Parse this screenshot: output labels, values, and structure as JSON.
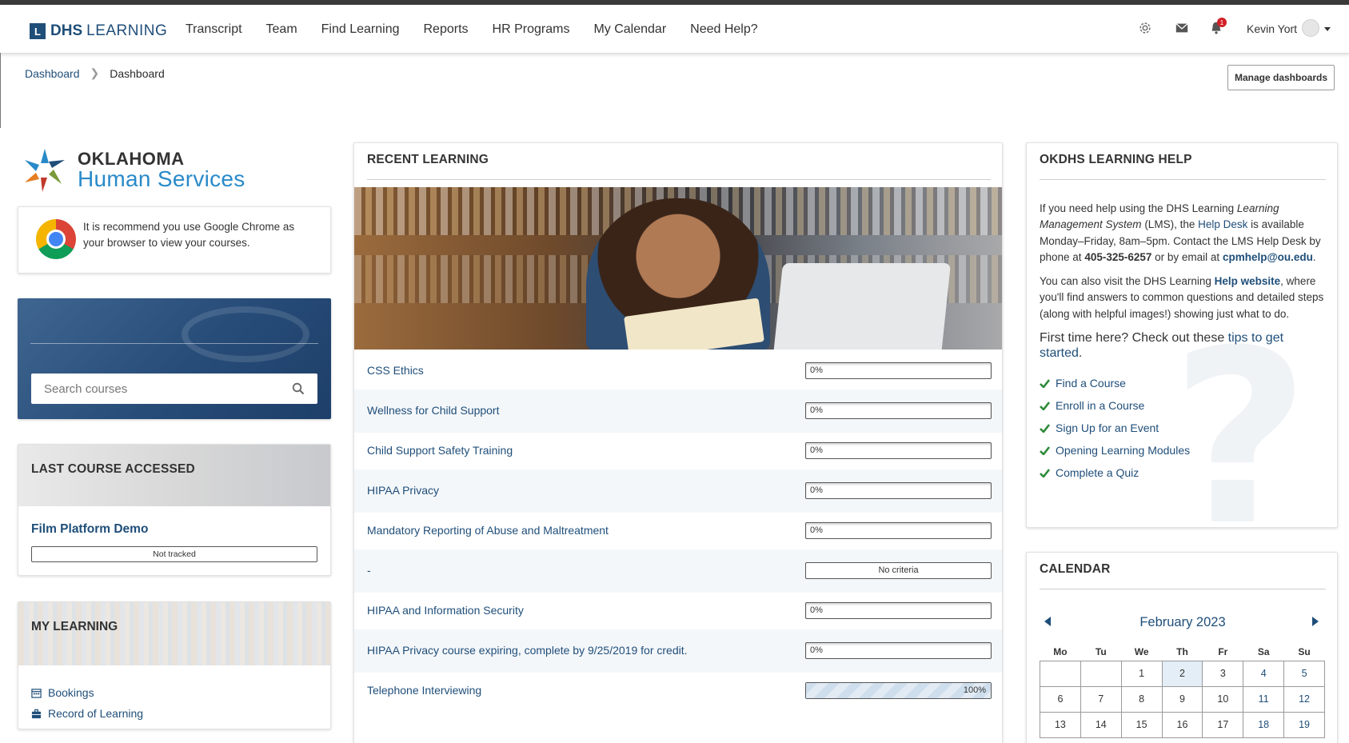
{
  "brand": {
    "box": "L",
    "bold": "DHS",
    "light": "LEARNING"
  },
  "nav": {
    "items": [
      "Transcript",
      "Team",
      "Find Learning",
      "Reports",
      "HR Programs",
      "My Calendar",
      "Need Help?"
    ],
    "icons": [
      "gear-icon",
      "envelope-icon",
      "bell-icon"
    ],
    "notification_count": "1",
    "user_name": "Kevin Yort"
  },
  "breadcrumb": {
    "link": "Dashboard",
    "current": "Dashboard"
  },
  "manage_dashboards": "Manage dashboards",
  "logo": {
    "line1": "OKLAHOMA",
    "line2": "Human Services"
  },
  "chrome_notice": "It is recommend you use Google Chrome as your browser to view your courses.",
  "search": {
    "placeholder": "Search courses"
  },
  "last_course": {
    "title": "LAST COURSE ACCESSED",
    "course": "Film Platform Demo",
    "status": "Not tracked"
  },
  "my_learning": {
    "title": "MY LEARNING",
    "items": [
      "Bookings",
      "Record of Learning"
    ]
  },
  "recent_learning": {
    "title": "RECENT LEARNING",
    "rows": [
      {
        "name": "CSS Ethics",
        "progress": "0%",
        "value": 0
      },
      {
        "name": "Wellness for Child Support",
        "progress": "0%",
        "value": 0
      },
      {
        "name": "Child Support Safety Training",
        "progress": "0%",
        "value": 0
      },
      {
        "name": "HIPAA Privacy",
        "progress": "0%",
        "value": 0
      },
      {
        "name": "Mandatory Reporting of Abuse and Maltreatment",
        "progress": "0%",
        "value": 0
      },
      {
        "name": "-",
        "progress": "No criteria",
        "value": null
      },
      {
        "name": "HIPAA and Information Security",
        "progress": "0%",
        "value": 0
      },
      {
        "name": "HIPAA Privacy course expiring, complete by 9/25/2019 for credit.",
        "progress": "0%",
        "value": 0
      },
      {
        "name": "Telephone Interviewing",
        "progress": "100%",
        "value": 100
      }
    ]
  },
  "help": {
    "title": "OKDHS LEARNING HELP",
    "p1_a": "If you need help using the DHS Learning ",
    "p1_italic": "Learning Management System",
    "p1_b": " (LMS), the ",
    "p1_link": "Help Desk",
    "p1_c": " is available Monday–Friday, 8am–5pm. Contact the LMS Help Desk by phone at ",
    "phone": "405-325-6257",
    "p1_d": " or by email at ",
    "email": "cpmhelp@ou.edu",
    "p1_e": ".",
    "p2_a": "You can also visit the DHS Learning ",
    "p2_link": "Help website",
    "p2_b": ", where you'll find answers to common questions and detailed steps (along with helpful images!) showing just what to do.",
    "first_a": "First time here? Check out these ",
    "first_link": "tips to get started",
    "first_b": ".",
    "tips": [
      "Find a Course",
      "Enroll in a Course",
      "Sign Up for an Event",
      "Opening Learning Modules",
      "Complete a Quiz"
    ]
  },
  "calendar": {
    "title": "CALENDAR",
    "month": "February 2023",
    "weekdays": [
      "Mo",
      "Tu",
      "We",
      "Th",
      "Fr",
      "Sa",
      "Su"
    ],
    "weeks": [
      [
        "",
        "",
        "1",
        "2",
        "3",
        "4",
        "5"
      ],
      [
        "6",
        "7",
        "8",
        "9",
        "10",
        "11",
        "12"
      ],
      [
        "13",
        "14",
        "15",
        "16",
        "17",
        "18",
        "19"
      ]
    ],
    "today": "2"
  },
  "colors": {
    "primary": "#1f4e79",
    "accent": "#2a8ac9",
    "check": "#2e8b3a",
    "notification": "#d21f26"
  }
}
